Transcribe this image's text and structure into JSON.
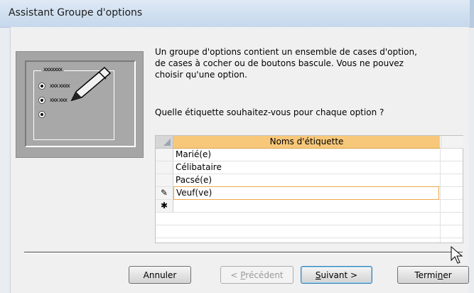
{
  "window": {
    "title": "Assistant Groupe d'options"
  },
  "illustration": {
    "group_label": "xxxxxxx",
    "option1": "xxx xxxx",
    "option2": "xxx xxx"
  },
  "description": {
    "line1": "Un groupe d'options contient un ensemble de cases d'option,",
    "line2": "de cases à cocher ou de boutons bascule. Vous ne pouvez",
    "line3": "choisir qu'une option."
  },
  "question": "Quelle étiquette souhaitez-vous pour chaque option ?",
  "grid": {
    "header": "Noms d'étiquette",
    "rows": [
      {
        "selector": "",
        "label": "Marié(e)"
      },
      {
        "selector": "",
        "label": "Célibataire"
      },
      {
        "selector": "",
        "label": "Pacsé(e)"
      },
      {
        "selector": "✎",
        "label": "Veuf(ve)"
      },
      {
        "selector": "✱",
        "label": ""
      }
    ]
  },
  "buttons": {
    "cancel": "Annuler",
    "previous_prefix": "< ",
    "previous_u": "P",
    "previous_rest": "récédent",
    "next_u": "S",
    "next_rest": "uivant >",
    "finish_pre": "Termi",
    "finish_u": "n",
    "finish_rest": "er"
  }
}
